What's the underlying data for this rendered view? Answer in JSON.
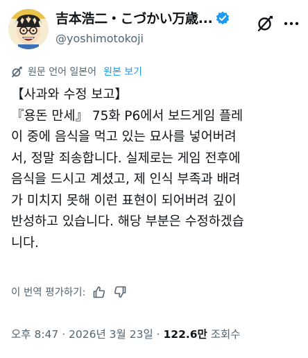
{
  "author": {
    "display_name": "吉本浩二・こづかい万歳...",
    "handle": "@yoshimotokoji"
  },
  "icons": {
    "verified": "verified-badge-icon",
    "grok": "grok-icon",
    "more": "more-icon",
    "translate": "translate-icon",
    "like": "thumbs-up-icon",
    "dislike": "thumbs-down-icon"
  },
  "colors": {
    "accent": "#1d9bf0",
    "secondary_text": "#536471",
    "text": "#0f1419"
  },
  "translation": {
    "note": "원문 언어 일본어",
    "show_original": "원본 보기"
  },
  "post": {
    "lines": [
      "【사과와 수정 보고】",
      "『용돈 만세』 75화 P6에서 보드게임 플레",
      "이 중에 음식을 먹고 있는 묘사를 넣어버려",
      "서, 정말 죄송합니다. 실제로는 게임 전후에",
      "음식을 드시고 계셨고, 제 인식 부족과 배려",
      "가 미치지 못해 이런 표현이 되어버려 깊이",
      "반성하고 있습니다. 해당 부분은 수정하겠습",
      "니다."
    ]
  },
  "rating": {
    "label": "이 번역 평가하기:"
  },
  "meta": {
    "time": "오후 8:47",
    "sep1": " · ",
    "date": "2026년 3월 23일",
    "sep2": " · ",
    "views_count": "122.6만",
    "views_label": " 조회수"
  }
}
